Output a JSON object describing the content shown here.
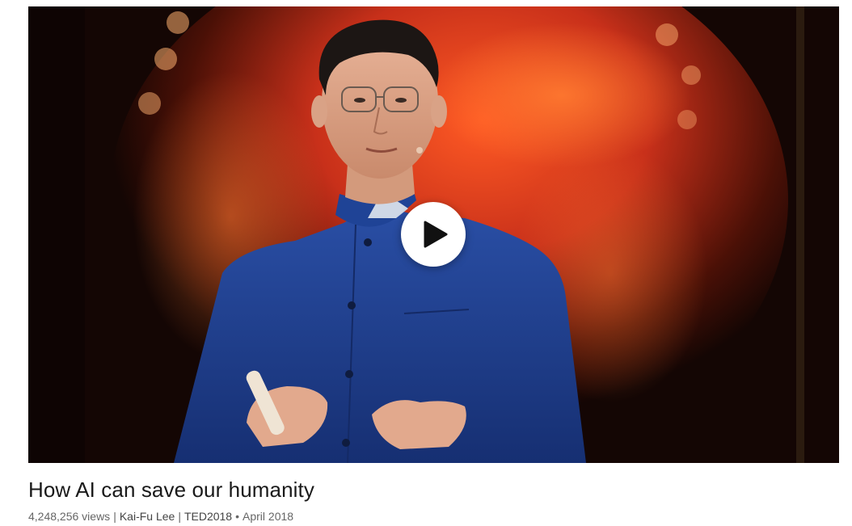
{
  "talk": {
    "title": "How AI can save our humanity",
    "views": "4,248,256 views",
    "speaker": "Kai-Fu Lee",
    "event": "TED2018",
    "date": "April 2018"
  },
  "separators": {
    "pipe": "|",
    "bullet": "•"
  },
  "icons": {
    "play": "play-icon"
  },
  "colors": {
    "stage_background": "#1a0805",
    "projection_red": "#d8321a",
    "projection_orange": "#f05a22",
    "suit_blue": "#1e3f8f",
    "play_button_fill": "#ffffff",
    "play_icon": "#111111",
    "title_text": "#1a1a1a",
    "meta_text": "#666666"
  }
}
